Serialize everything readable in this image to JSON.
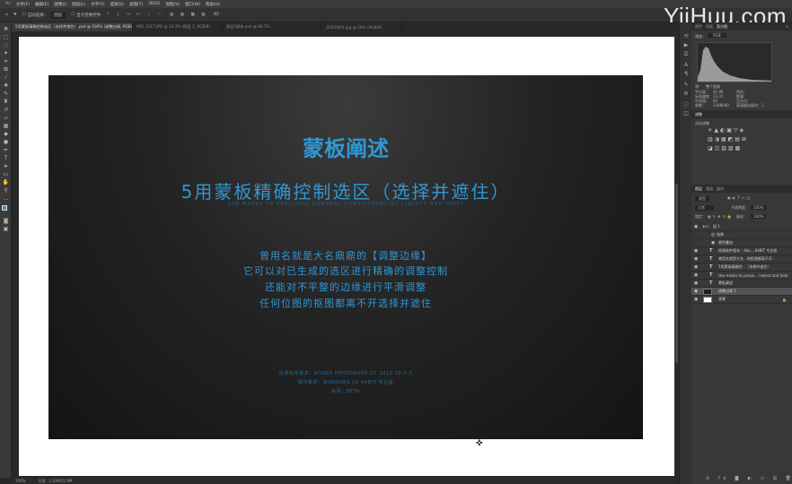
{
  "menubar": {
    "items": [
      "文件(F)",
      "编辑(E)",
      "图像(I)",
      "图层(L)",
      "文字(Y)",
      "选择(S)",
      "滤镜(T)",
      "3D(D)",
      "视图(V)",
      "窗口(W)",
      "帮助(H)"
    ]
  },
  "options_bar": {
    "auto_select_label": "自动选择：",
    "auto_select_value": "图层",
    "show_transform_label": "显示变换控件"
  },
  "watermark": "YiiHuu.com",
  "tabs": [
    {
      "label": "5用蒙板精确控制选区（选择并遮住）.psd @ 100% (调整边缘, RGB/8) *",
      "active": true
    },
    {
      "label": "IMG_5517.JPG @ 33.3% (图层 1, RGB/8)",
      "active": false
    },
    {
      "label": "图层1副本.psd @ 66.7%...",
      "active": false
    },
    {
      "label": "_DSC0001.jpg @ 50% (RGB/8)",
      "active": false
    }
  ],
  "artwork": {
    "title": "蒙板阐述",
    "subtitle": "5用蒙板精确控制选区（选择并遮住）",
    "subtitle_en": "USE MASKS TO PRECISELY CONTROL CONSTITUENCIES (SELECT AND HIDE)",
    "body": [
      "曾用名就是大名鼎鼎的【调整边缘】",
      "它可以对已生成的选区进行精确的调整控制",
      "还能对不平整的边缘进行平滑调整",
      "任何位图的抠图都离不开选择并遮住"
    ],
    "footer": [
      "授课软件版本：ADOBE PHOTOSHOP CC 2019 20.0.2",
      "操作系统：WINDOWS 10 64BIT 专业版",
      "讲师：BETA"
    ]
  },
  "statusbar": {
    "zoom": "100%",
    "doc": "文档：1.93M/32.9M"
  },
  "panels": {
    "top_tabs": [
      "颜色",
      "色板",
      "直方图"
    ],
    "top_active": "直方图",
    "channel_label": "通道：",
    "channel_value": "RGB",
    "source_label": "源：",
    "source_value": "整个图像",
    "stats_left": [
      "平均值：",
      "标准偏差：",
      "中间值：",
      "像素："
    ],
    "stats_left_values": [
      "41.96",
      "23.31",
      "40",
      "1308000"
    ],
    "stats_right": [
      "色阶：",
      "数量：",
      "百分位：",
      "高速缓存级别："
    ],
    "stats_right_values": [
      "",
      "",
      "",
      "1"
    ],
    "adjust_tab": "调整",
    "adjust_title": "添加调整",
    "layers_tabs": [
      "图层",
      "通道",
      "路径"
    ],
    "layers_active": "图层",
    "kind_label": "类型",
    "blend_mode": "正常",
    "opacity_label": "不透明度：",
    "opacity_value": "100%",
    "lock_label": "锁定：",
    "fill_label": "填充：",
    "fill_value": "100%",
    "layers": [
      {
        "name": "组 1",
        "type": "folder",
        "selected": false
      },
      {
        "name": "效果",
        "type": "fx",
        "selected": false
      },
      {
        "name": "颜色叠加",
        "type": "effect",
        "selected": false
      },
      {
        "name": "授课软件版本：Ado... 64BIT 专业版",
        "type": "T",
        "selected": false
      },
      {
        "name": "曾用名就是大名...的抠图都离不开...",
        "type": "T",
        "selected": false
      },
      {
        "name": "5用蒙板精确控...（选择并遮住）",
        "type": "T",
        "selected": false
      },
      {
        "name": "Use masks to precis... (select and hide)",
        "type": "T",
        "selected": false
      },
      {
        "name": "蒙板阐述",
        "type": "T",
        "selected": false
      },
      {
        "name": "调整边缘 1",
        "type": "image",
        "selected": true
      },
      {
        "name": "背景",
        "type": "bg",
        "selected": false
      }
    ]
  }
}
